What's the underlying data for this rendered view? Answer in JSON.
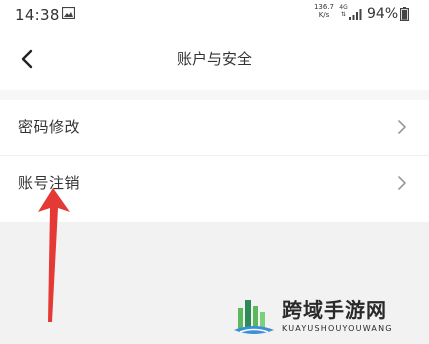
{
  "status_bar": {
    "time": "14:38",
    "network_speed_value": "136.7",
    "network_speed_unit": "K/s",
    "network_type": "4G",
    "battery": "94%",
    "icons": [
      "image-icon",
      "signal-icon",
      "battery-icon"
    ]
  },
  "header": {
    "title": "账户与安全",
    "back_icon": "chevron-left-icon"
  },
  "settings_list": {
    "items": [
      {
        "label": "密码修改",
        "icon": "chevron-right-icon"
      },
      {
        "label": "账号注销",
        "icon": "chevron-right-icon"
      }
    ]
  },
  "annotation": {
    "color": "#e53935"
  },
  "watermark": {
    "title": "跨域手游网",
    "subtitle": "KUAYUSHOUYOUWANG"
  },
  "colors": {
    "background": "#f2f2f2",
    "surface": "#ffffff",
    "text": "#333333",
    "chevron": "#9a9a9a"
  }
}
